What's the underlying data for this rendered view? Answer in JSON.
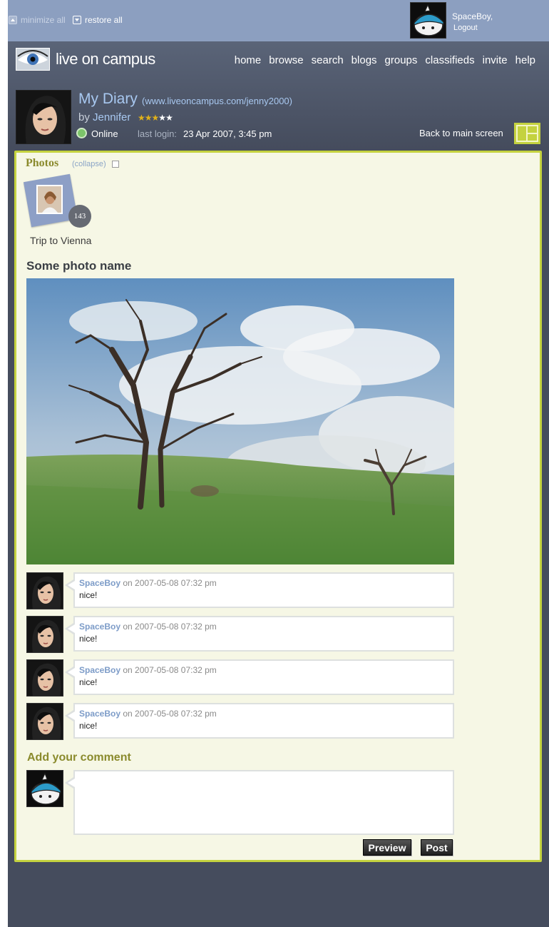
{
  "topbar": {
    "minimize_all": "minimize all",
    "restore_all": "restore all",
    "username": "SpaceBoy,",
    "logout": "Logout"
  },
  "header": {
    "logo_text": "live on campus",
    "nav": [
      "home",
      "browse",
      "search",
      "blogs",
      "groups",
      "classifieds",
      "invite",
      "help"
    ]
  },
  "profile": {
    "title": "My Diary",
    "url": "(www.liveoncampus.com/jenny2000)",
    "by_prefix": "by",
    "author": "Jennifer",
    "rating_stars": 3,
    "rating_max": 5,
    "status": "Online",
    "last_login_label": "last login:",
    "last_login_value": "23 Apr 2007, 3:45 pm",
    "back_label": "Back to main screen"
  },
  "photos": {
    "section_title": "Photos",
    "collapse_label": "(collapse)",
    "album": {
      "name": "Trip to Vienna",
      "count": "143"
    },
    "photo_name": "Some photo name"
  },
  "comments": [
    {
      "author": "SpaceBoy",
      "date": "on 2007-05-08 07:32 pm",
      "text": "nice!"
    },
    {
      "author": "SpaceBoy",
      "date": "on 2007-05-08 07:32 pm",
      "text": "nice!"
    },
    {
      "author": "SpaceBoy",
      "date": "on 2007-05-08 07:32 pm",
      "text": "nice!"
    },
    {
      "author": "SpaceBoy",
      "date": "on 2007-05-08 07:32 pm",
      "text": "nice!"
    }
  ],
  "add_comment": {
    "title": "Add your comment",
    "placeholder": "",
    "preview_label": "Preview",
    "post_label": "Post"
  },
  "colors": {
    "topbar": "#8c9fc0",
    "main_bg": "#454c5d",
    "panel_bg": "#f6f7e5",
    "panel_border": "#c4d23f",
    "link": "#7d9cc8",
    "olive_heading": "#8a8a2c",
    "star_on": "#e0b11a",
    "star_off": "#ffffff"
  }
}
